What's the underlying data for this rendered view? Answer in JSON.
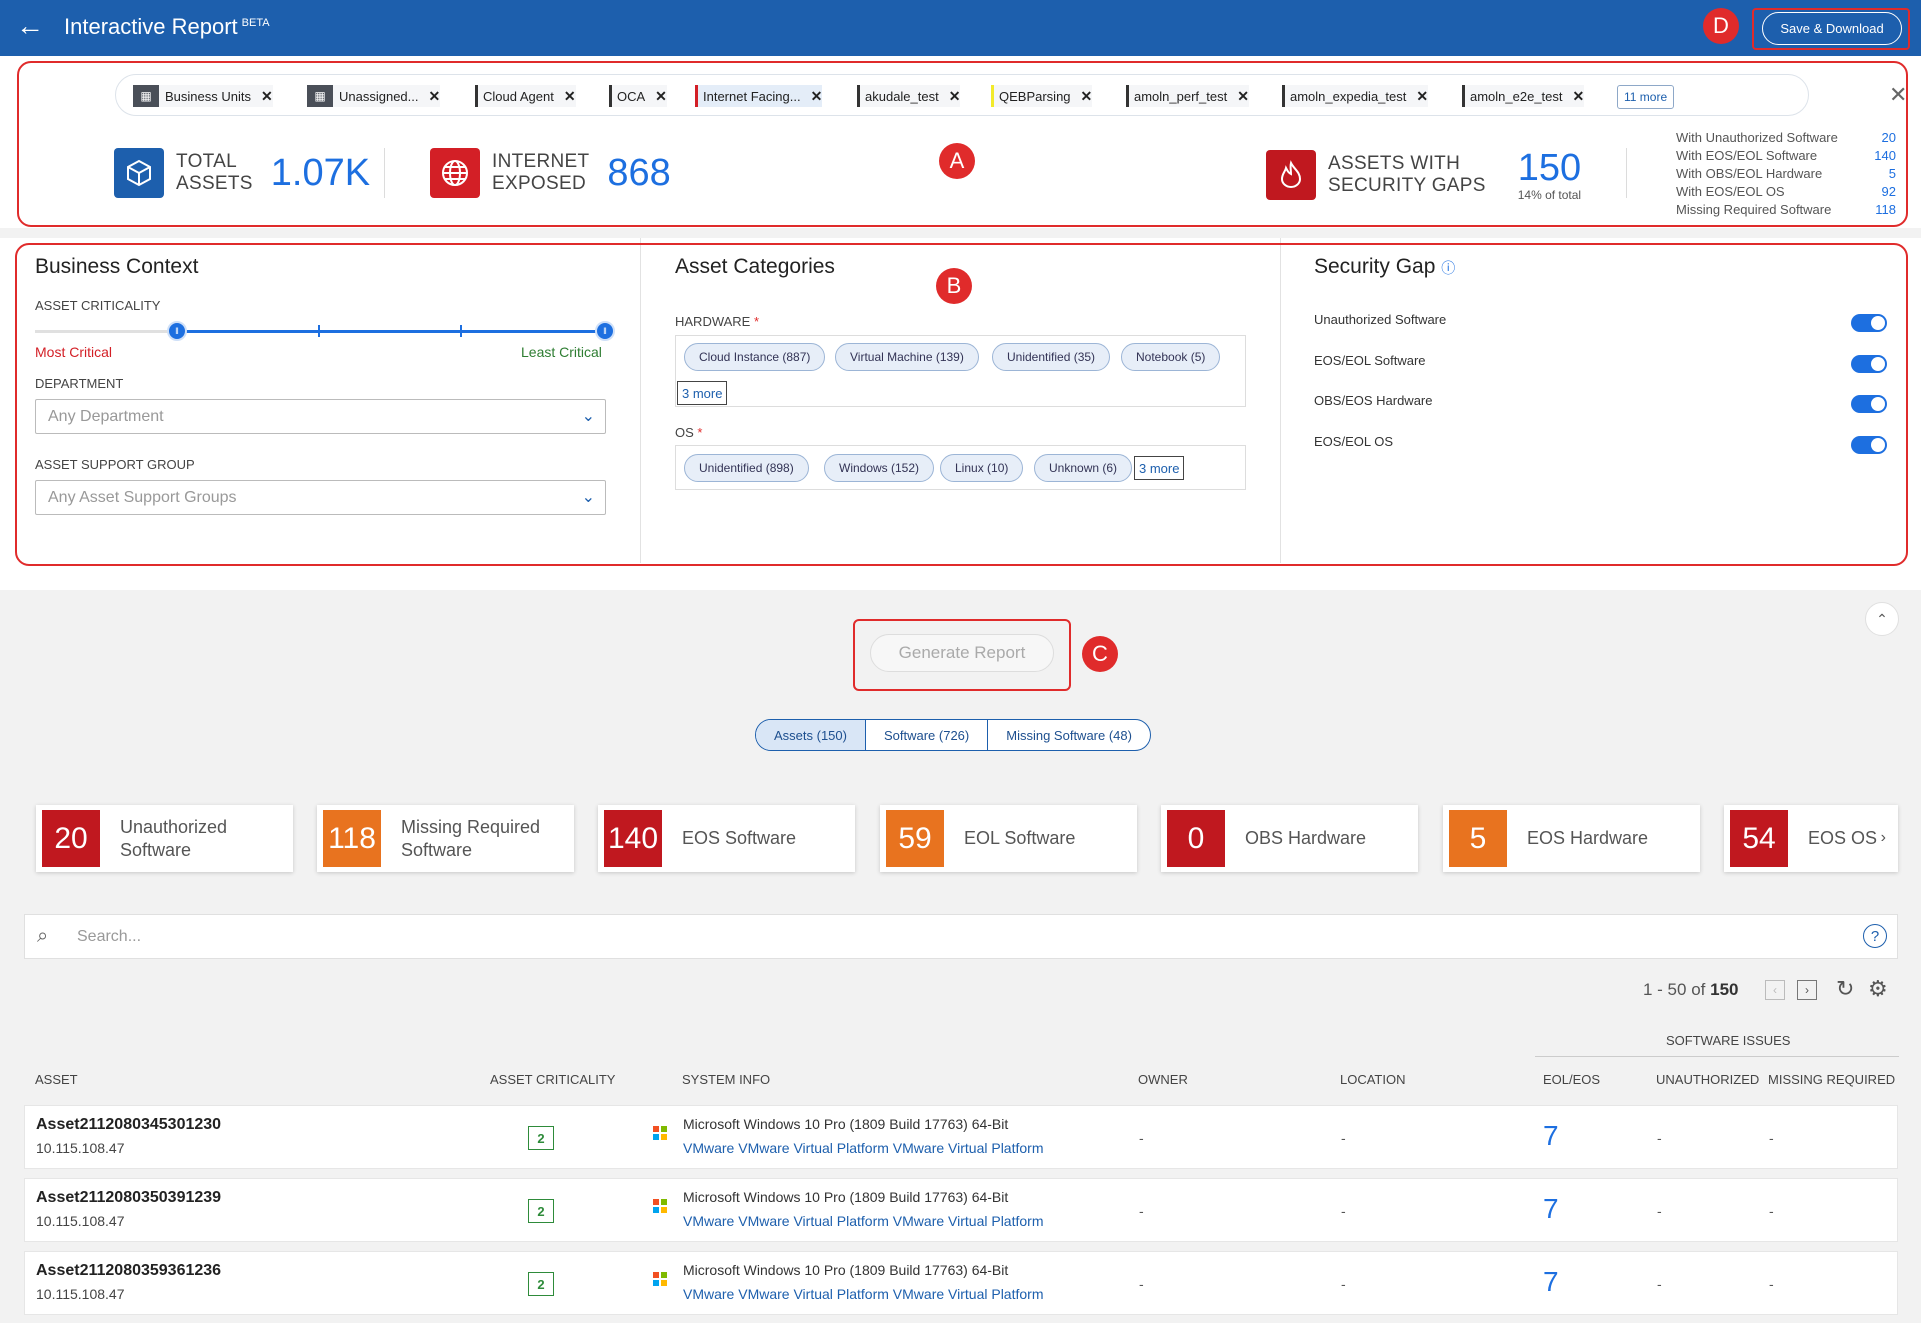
{
  "header": {
    "title": "Interactive Report",
    "beta": "BETA",
    "save_label": "Save & Download"
  },
  "callouts": {
    "a": "A",
    "b": "B",
    "c": "C",
    "d": "D"
  },
  "filters": {
    "chips": [
      "Business Units",
      "Unassigned...",
      "Cloud Agent",
      "OCA",
      "Internet Facing...",
      "akudale_test",
      "QEBParsing",
      "amoln_perf_test",
      "amoln_expedia_test",
      "amoln_e2e_test"
    ],
    "more": "11 more"
  },
  "stats": {
    "total_label_1": "TOTAL",
    "total_label_2": "ASSETS",
    "total_value": "1.07K",
    "internet_label_1": "INTERNET",
    "internet_label_2": "EXPOSED",
    "internet_value": "868",
    "gaps_label_1": "ASSETS WITH",
    "gaps_label_2": "SECURITY GAPS",
    "gaps_value": "150",
    "gaps_sub": "14% of total"
  },
  "breakdown": [
    {
      "label": "With Unauthorized Software",
      "value": "20"
    },
    {
      "label": "With EOS/EOL Software",
      "value": "140"
    },
    {
      "label": "With OBS/EOL Hardware",
      "value": "5"
    },
    {
      "label": "With EOS/EOL OS",
      "value": "92"
    },
    {
      "label": "Missing Required Software",
      "value": "118"
    }
  ],
  "business_context": {
    "title": "Business Context",
    "criticality_label": "ASSET CRITICALITY",
    "most": "Most Critical",
    "least": "Least Critical",
    "department_label": "DEPARTMENT",
    "department_placeholder": "Any Department",
    "support_label": "ASSET SUPPORT GROUP",
    "support_placeholder": "Any Asset Support Groups"
  },
  "asset_categories": {
    "title": "Asset Categories",
    "hardware_label": "HARDWARE",
    "hardware_tags": [
      "Cloud Instance (887)",
      "Virtual Machine (139)",
      "Unidentified (35)",
      "Notebook (5)"
    ],
    "hardware_more": "3 more",
    "os_label": "OS",
    "os_tags": [
      "Unidentified (898)",
      "Windows (152)",
      "Linux (10)",
      "Unknown (6)"
    ],
    "os_more": "3 more",
    "required_mark": "*"
  },
  "security_gap": {
    "title": "Security Gap",
    "items": [
      "Unauthorized Software",
      "EOS/EOL Software",
      "OBS/EOS Hardware",
      "EOS/EOL OS"
    ]
  },
  "generate_label": "Generate Report",
  "tabs": [
    "Assets (150)",
    "Software (726)",
    "Missing Software (48)"
  ],
  "cards": [
    {
      "value": "20",
      "label_1": "Unauthorized",
      "label_2": "Software",
      "color": "#c0181f"
    },
    {
      "value": "118",
      "label_1": "Missing Required",
      "label_2": "Software",
      "color": "#e8731f"
    },
    {
      "value": "140",
      "label_1": "EOS Software",
      "label_2": "",
      "color": "#c0181f"
    },
    {
      "value": "59",
      "label_1": "EOL Software",
      "label_2": "",
      "color": "#e8731f"
    },
    {
      "value": "0",
      "label_1": "OBS Hardware",
      "label_2": "",
      "color": "#c0181f"
    },
    {
      "value": "5",
      "label_1": "EOS Hardware",
      "label_2": "",
      "color": "#e8731f"
    },
    {
      "value": "54",
      "label_1": "EOS OS",
      "label_2": "",
      "color": "#c0181f"
    }
  ],
  "search_placeholder": "Search...",
  "pager": {
    "range": "1 - 50 of",
    "total": "150"
  },
  "table": {
    "group_header": "SOFTWARE ISSUES",
    "columns": [
      "ASSET",
      "ASSET CRITICALITY",
      "SYSTEM INFO",
      "OWNER",
      "LOCATION",
      "EOL/EOS",
      "UNAUTHORIZED",
      "MISSING REQUIRED"
    ],
    "rows": [
      {
        "name": "Asset2112080345301230",
        "ip": "10.115.108.47",
        "criticality": "2",
        "os": "Microsoft Windows 10 Pro (1809 Build 17763) 64-Bit",
        "platform": "VMware VMware Virtual Platform VMware Virtual Platform",
        "owner": "-",
        "location": "-",
        "eol": "7",
        "unauth": "-",
        "missing": "-"
      },
      {
        "name": "Asset2112080350391239",
        "ip": "10.115.108.47",
        "criticality": "2",
        "os": "Microsoft Windows 10 Pro (1809 Build 17763) 64-Bit",
        "platform": "VMware VMware Virtual Platform VMware Virtual Platform",
        "owner": "-",
        "location": "-",
        "eol": "7",
        "unauth": "-",
        "missing": "-"
      },
      {
        "name": "Asset2112080359361236",
        "ip": "10.115.108.47",
        "criticality": "2",
        "os": "Microsoft Windows 10 Pro (1809 Build 17763) 64-Bit",
        "platform": "VMware VMware Virtual Platform VMware Virtual Platform",
        "owner": "-",
        "location": "-",
        "eol": "7",
        "unauth": "-",
        "missing": "-"
      }
    ]
  }
}
